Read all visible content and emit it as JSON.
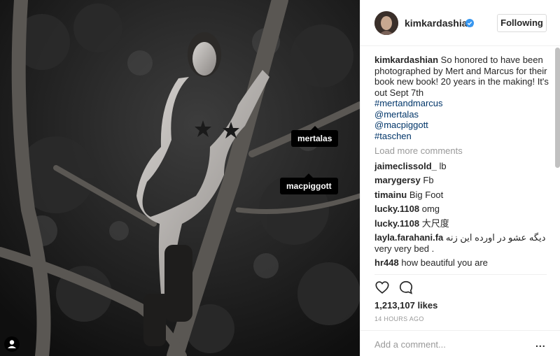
{
  "photo": {
    "tags": [
      {
        "label": "mertalas"
      },
      {
        "label": "macpiggott"
      }
    ]
  },
  "header": {
    "username": "kimkardashian",
    "follow_label": "Following"
  },
  "caption": {
    "username": "kimkardashian",
    "text": "So honored to have been photographed by Mert and Marcus for their book new book! 20 years in the making! It's out Sept 7th",
    "hashtags": [
      "#mertandmarcus",
      "@mertalas",
      "@macpiggott",
      "#taschen"
    ]
  },
  "load_more": "Load more comments",
  "comments": [
    {
      "user": "jaimeclissold_",
      "text": "lb"
    },
    {
      "user": "marygersy",
      "text": "Fb"
    },
    {
      "user": "timainu",
      "text": "Big Foot"
    },
    {
      "user": "lucky.1108",
      "text": "omg"
    },
    {
      "user": "lucky.1108",
      "text": "大尺度"
    },
    {
      "user": "layla.farahani.fa",
      "text": "دیگه عشو در اورده این زنه very very bed ."
    },
    {
      "user": "hr448",
      "text": "how beautiful you are"
    }
  ],
  "likes": "1,213,107 likes",
  "timestamp": "14 HOURS AGO",
  "add_comment_placeholder": "Add a comment...",
  "more_label": "...",
  "colors": {
    "verified": "#3897f0",
    "link": "#003569",
    "muted": "#999999"
  },
  "icons": [
    "heart-icon",
    "comment-icon",
    "verified-icon",
    "user-tag-icon",
    "more-icon"
  ]
}
